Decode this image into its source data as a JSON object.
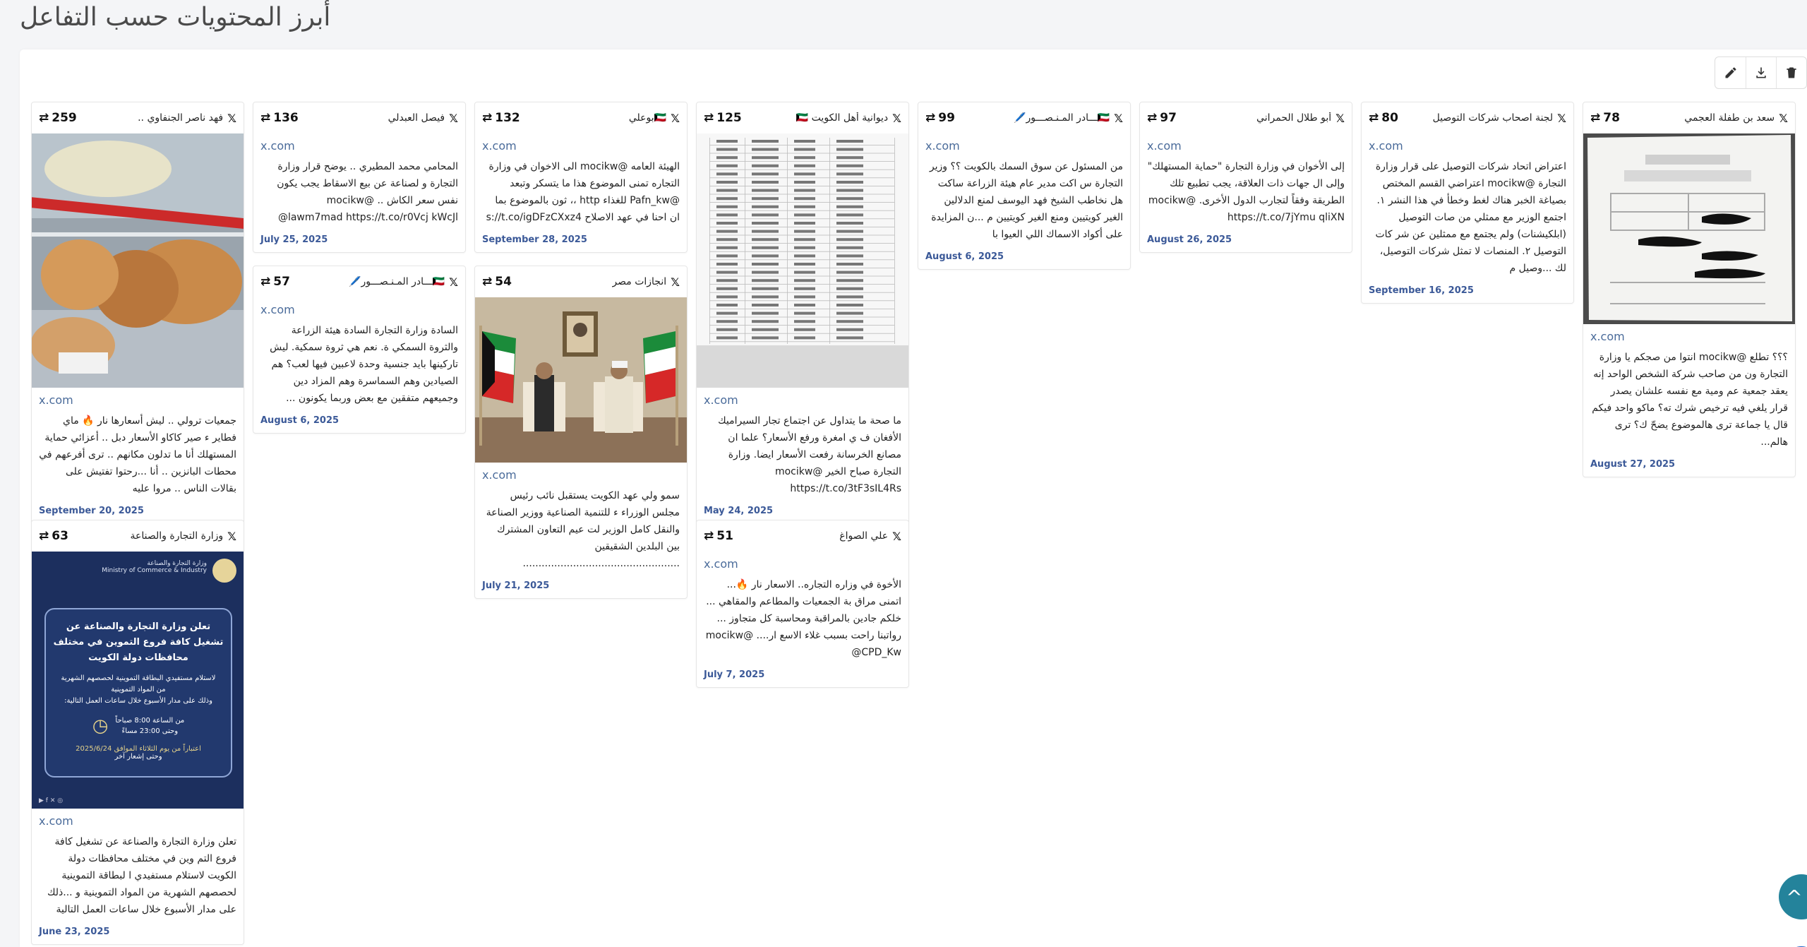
{
  "page": {
    "title": "أبرز المحتويات حسب التفاعل"
  },
  "toolbar": {
    "edit": "edit-icon",
    "download": "download-icon",
    "delete": "trash-icon"
  },
  "colors": {
    "accent": "#24839b",
    "date": "#3b5998",
    "source": "#4a6b9a"
  },
  "cards": [
    {
      "author": "سعد بن طفلة العجمي",
      "retweets": "78",
      "source": "x.com",
      "text": "؟؟؟ تطلع @mocikw انتوا من صجكم يا وزارة التجارة ون من صاحب شركة الشخص الواحد إنه يعقد جمعية عم ومية مع نفسه علشان يصدر قرار يلغي فيه ترخيص شرك ته؟ ماكو واحد فيكم قال يا جماعة ترى هالموضوع يضحّ ك؟ ترى هالم...",
      "date": "August 27, 2025"
    },
    {
      "author": "لجنة اصحاب شركات التوصيل",
      "retweets": "80",
      "source": "x.com",
      "text": "اعتراض اتحاد شركات التوصيل على قرار وزارة التجارة @mocikw اعتراضي القسم المختص بصياغة الخبر هناك لغط وخطأ في هذا النشر ١. اجتمع الوزير مع ممثلي من صات التوصيل (ابلكيشنات) ولم يجتمع مع ممثلين عن شر كات التوصيل ٢. المنصات لا تمثل شركات التوصيل، لك ...وصيل م",
      "date": "September 16, 2025"
    },
    {
      "author": "أبو طلال الحمراني",
      "retweets": "97",
      "source": "x.com",
      "text": "إلى الأخوان في وزارة التجارة \"حماية المستهلك\" وإلى ال جهات ذات العلاقة، يجب تطبيع تلك الطريقة وفقاً لتجارب الدول الأخرى. @mocikw https://t.co/7jYmu qliXN",
      "date": "August 26, 2025"
    },
    {
      "author": "🇰🇼ـــادر المـنـصـــور🖊️",
      "retweets": "99",
      "source": "x.com",
      "text": "من المسئول عن سوق السمك بالكويت ؟؟ وزير التجارة س اكت مدير عام هيئة الزراعة ساكت هل نخاطب الشيخ فهد اليوسف لمنع الدلالين الغير كويتيين ومنع الغير كويتيين م ...ن المزايدة على أكواد الاسماك اللي العيوا با",
      "date": "August 6, 2025"
    },
    {
      "author": "ديوانية أهل الكويت 🇰🇼",
      "retweets": "125",
      "source": "x.com",
      "text": "ما صحة ما يتداول عن اجتماع تجار السيراميك الأفغان ف ي امغرة ورفع الأسعار؟ علما ان مصانع الخرسانة رفعت الأسعار ايضا. وزارة التجارة صباح الخير @mocikw https://t.co/3tF3sIL4Rs",
      "date": "May 24, 2025"
    },
    {
      "author": "🇰🇼بوعلي",
      "retweets": "132",
      "source": "x.com",
      "text": "الهيئة العامه @mocikw الى الاخوان في وزارة التجاره تمنى الموضوع هذا ما يتسكر وتبعد @Pafn_kw للغذاء http ،، ثون بالموضوع بما ان احنا في عهد الاصلاح s://t.co/igDFzCXxz4",
      "date": "September 28, 2025"
    },
    {
      "author": "فيصل العبدلي",
      "retweets": "136",
      "source": "x.com",
      "text": "المحامي محمد المطيري .. يوضح قرار وزارة التجارة و لصناعة عن بيع الاسقاط يجب يكون نفس سعر الكاش .. @mocikw @lawm7mad https://t.co/r0Vcj kWcJl",
      "date": "July 25, 2025"
    },
    {
      "author": "فهد ناصر الجنفاوي ..",
      "retweets": "259",
      "source": "x.com",
      "text": "جمعيات ترولي .. ليش أسعارها نار 🔥 ماي فطاير ء صير كاكاو الأسعار دبل .. أعزائي حماية المستهلك أنا ما تدلون مكانهم .. ترى أفرعهم في محطات البانزين .. أنا ...رحتوا تفتيش على بقالات الناس .. مروا عليه",
      "date": "September 20, 2025"
    },
    {
      "author": "علي الصواغ",
      "retweets": "51",
      "source": "x.com",
      "text": "الأخوة في وزاره التجاره.. الاسعار نار 🔥... اتمنى مراق بة الجمعيات والمطاعم والمقاهي ... خلكم جادين بالمراقبة ومحاسبة كل متجاوز ... رواتبنا راحت بسبب غلاء الاسع ار.... @mocikw @CPD_Kw",
      "date": "July 7, 2025"
    },
    {
      "author": "انجازات مصر",
      "retweets": "54",
      "source": "x.com",
      "text": "سمو ولي عهد الكويت يستقبل نائب رئيس مجلس الوزراء ء للتنمية الصناعية ووزير الصناعة والنقل كامل الوزير لت عيم التعاون المشترك بين البلدين الشقيقين ..................................................",
      "date": "July 21, 2025"
    },
    {
      "author": "🇰🇼ـــادر المـنـصـــور🖊️",
      "retweets": "57",
      "source": "x.com",
      "text": "السادة وزارة التجارة السادة هيئة الزراعة والثروة السمكي ة. نعم هي ثروة سمكية. ليش تاركينها بايد جنسية وحدة لاعبين فيها لعب؟ هم الصيادين وهم السماسرة وهم المزاد دين وجميعهم متفقين مع بعض وربما يكونون ...",
      "date": "August 6, 2025"
    },
    {
      "author": "وزارة التجارة والصناعة",
      "retweets": "63",
      "source": "x.com",
      "text": "تعلن وزارة التجارة والصناعة عن تشغيل كافة فروع التم وين في مختلف محافظات دولة الكويت لاستلام مستفيدي ا لبطاقة التموينية لحصصهم الشهرية من المواد التموينية و ...ذلك على مدار الأسبوع خلال ساعات العمل التالية",
      "date": "June 23, 2025"
    }
  ],
  "ministry_poster": {
    "header_line1": "وزارة التجارة والصناعة",
    "header_line2": "Ministry of Commerce & Industry",
    "headline": "تعلن وزارة التجارة والصناعة عن تشغيل كافة فروع التموين في مختلف محافظات دولة الكويت",
    "sub1": "لاستلام مستفيدي البطاقة التموينية لحصصهم الشهرية",
    "sub2": "من المواد التموينية",
    "sub3": "وذلك على مدار الأسبوع خلال ساعات العمل التالية:",
    "time1": "من الساعة 8:00 صباحاً",
    "time2": "وحتى 23:00 مساءً",
    "date1": "اعتباراً من يوم الثلاثاء الموافق 2025/6/24",
    "date2": "وحتى إشعار آخر"
  },
  "scroll_top": "^"
}
